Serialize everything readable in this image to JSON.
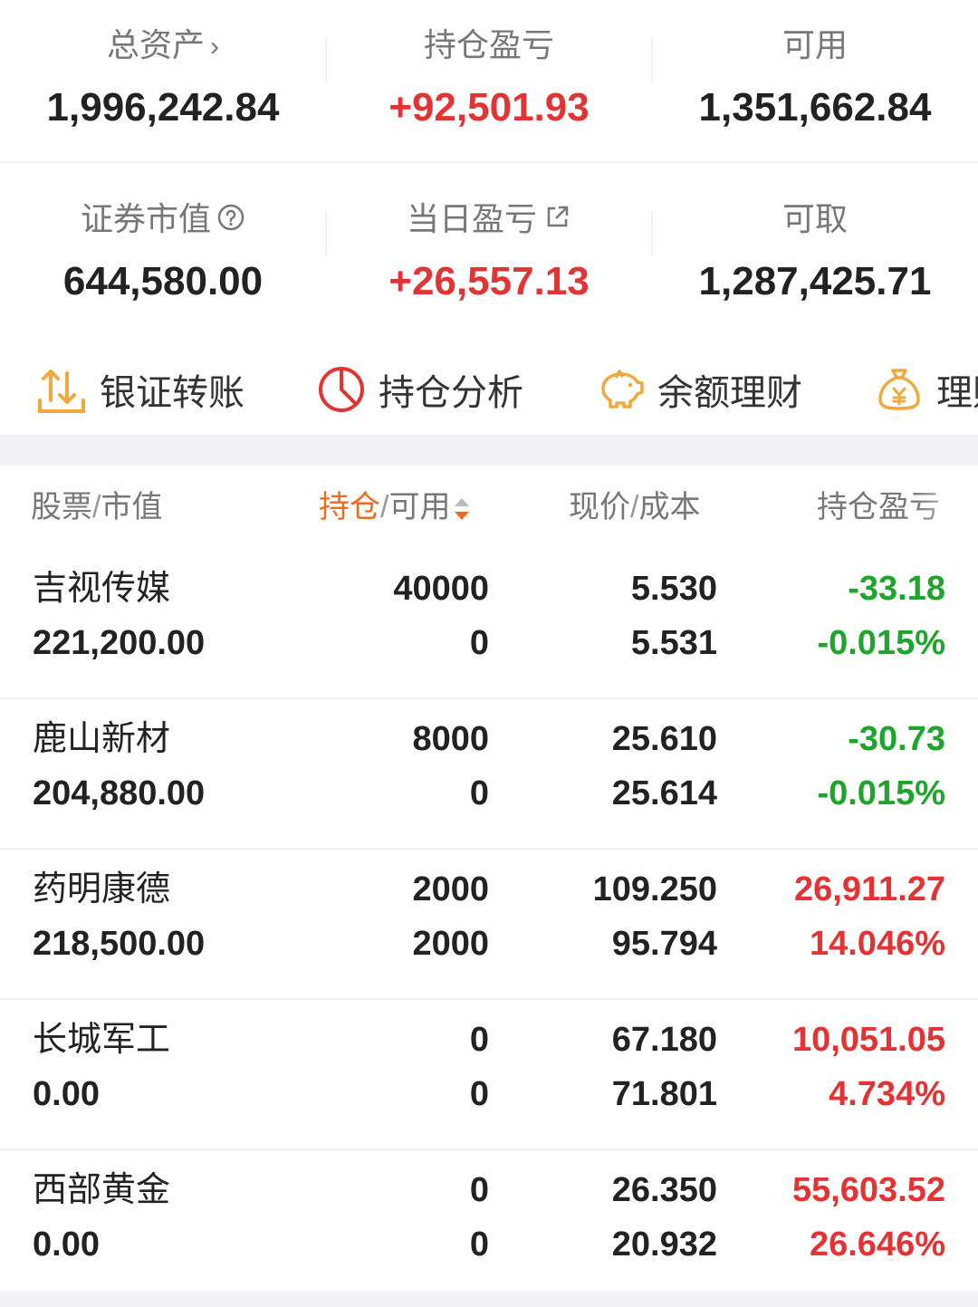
{
  "summary": {
    "row1": [
      {
        "label": "总资产",
        "value": "1,996,242.84"
      },
      {
        "label": "持仓盈亏",
        "value": "+92,501.93"
      },
      {
        "label": "可用",
        "value": "1,351,662.84"
      }
    ],
    "row2": [
      {
        "label": "证券市值",
        "value": "644,580.00"
      },
      {
        "label": "当日盈亏",
        "value": "+26,557.13"
      },
      {
        "label": "可取",
        "value": "1,287,425.71"
      }
    ]
  },
  "quick_actions": [
    {
      "label": "银证转账",
      "icon": "transfer-icon"
    },
    {
      "label": "持仓分析",
      "icon": "pie-chart-icon"
    },
    {
      "label": "余额理财",
      "icon": "piggy-bank-icon"
    },
    {
      "label": "理财",
      "icon": "money-bag-icon"
    }
  ],
  "table": {
    "headers": {
      "stock": "股票",
      "market_value": "市值",
      "position": "持仓",
      "available": "可用",
      "price": "现价",
      "cost": "成本",
      "pl": "持仓盈亏"
    },
    "rows": [
      {
        "name": "吉视传媒",
        "market_value": "221,200.00",
        "position": "40000",
        "available": "0",
        "price": "5.530",
        "cost": "5.531",
        "pl": "-33.18",
        "pl_pct": "-0.015%",
        "trend": "down"
      },
      {
        "name": "鹿山新材",
        "market_value": "204,880.00",
        "position": "8000",
        "available": "0",
        "price": "25.610",
        "cost": "25.614",
        "pl": "-30.73",
        "pl_pct": "-0.015%",
        "trend": "down"
      },
      {
        "name": "药明康德",
        "market_value": "218,500.00",
        "position": "2000",
        "available": "2000",
        "price": "109.250",
        "cost": "95.794",
        "pl": "26,911.27",
        "pl_pct": "14.046%",
        "trend": "up"
      },
      {
        "name": "长城军工",
        "market_value": "0.00",
        "position": "0",
        "available": "0",
        "price": "67.180",
        "cost": "71.801",
        "pl": "10,051.05",
        "pl_pct": "4.734%",
        "trend": "up"
      },
      {
        "name": "西部黄金",
        "market_value": "0.00",
        "position": "0",
        "available": "0",
        "price": "26.350",
        "cost": "20.932",
        "pl": "55,603.52",
        "pl_pct": "26.646%",
        "trend": "up"
      }
    ]
  },
  "colors": {
    "up": "#e23434",
    "down": "#1ea52c",
    "accent": "#ef6a1b",
    "icon": "#f2a93b"
  }
}
